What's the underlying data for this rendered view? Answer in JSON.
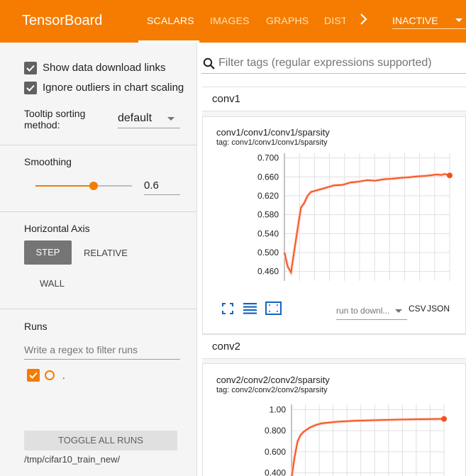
{
  "app": {
    "title": "TensorBoard"
  },
  "tabs": [
    "SCALARS",
    "IMAGES",
    "GRAPHS",
    "DIST"
  ],
  "tab_more_icon": "chevron-right-icon",
  "status_select": {
    "value": "INACTIVE"
  },
  "colors": {
    "brand": "#f57c00",
    "sidebar_bg": "#f5f5f5",
    "series": "#f4511e"
  },
  "sidebar": {
    "show_download_links": {
      "label": "Show data download links",
      "checked": true
    },
    "ignore_outliers": {
      "label": "Ignore outliers in chart scaling",
      "checked": true
    },
    "tooltip_sorting": {
      "label": "Tooltip sorting method:",
      "value": "default"
    },
    "smoothing": {
      "label": "Smoothing",
      "value": "0.6",
      "fraction": 0.6
    },
    "horizontal_axis": {
      "label": "Horizontal Axis",
      "options": [
        "STEP",
        "RELATIVE",
        "WALL"
      ],
      "selected": "STEP"
    },
    "runs": {
      "label": "Runs",
      "filter_placeholder": "Write a regex to filter runs",
      "items": [
        {
          "name": ".",
          "checked": true
        }
      ],
      "toggle_label": "TOGGLE ALL RUNS",
      "logdir": "/tmp/cifar10_train_new/"
    }
  },
  "search": {
    "placeholder": "Filter tags (regular expressions supported)"
  },
  "groups": [
    {
      "name": "conv1",
      "card": {
        "title": "conv1/conv1/conv1/sparsity",
        "tag": "tag: conv1/conv1/conv1/sparsity",
        "download_placeholder": "run to downl...",
        "links": [
          "CSV",
          "JSON"
        ]
      }
    },
    {
      "name": "conv2",
      "card": {
        "title": "conv2/conv2/conv2/sparsity",
        "tag": "tag: conv2/conv2/conv2/sparsity"
      }
    }
  ],
  "chart_data": [
    {
      "type": "line",
      "title": "conv1/conv1/conv1/sparsity",
      "ytick_labels": [
        "0.700",
        "0.660",
        "0.620",
        "0.580",
        "0.540",
        "0.500",
        "0.460"
      ],
      "ylim": [
        0.44,
        0.71
      ],
      "xlim": [
        0,
        1
      ],
      "series": [
        {
          "x": [
            0.0,
            0.02,
            0.04,
            0.06,
            0.08,
            0.1,
            0.12,
            0.14,
            0.16,
            0.2,
            0.25,
            0.3,
            0.35,
            0.4,
            0.45,
            0.5,
            0.55,
            0.6,
            0.65,
            0.7,
            0.75,
            0.8,
            0.85,
            0.88,
            0.92,
            0.95,
            0.97,
            1.0
          ],
          "y": [
            0.5,
            0.47,
            0.458,
            0.505,
            0.55,
            0.595,
            0.605,
            0.62,
            0.628,
            0.632,
            0.637,
            0.642,
            0.643,
            0.648,
            0.65,
            0.653,
            0.652,
            0.655,
            0.656,
            0.658,
            0.659,
            0.661,
            0.662,
            0.663,
            0.665,
            0.664,
            0.666,
            0.663
          ]
        }
      ],
      "grid": true
    },
    {
      "type": "line",
      "title": "conv2/conv2/conv2/sparsity",
      "ytick_labels": [
        "1.00",
        "0.800",
        "0.600",
        "0.400"
      ],
      "ylim": [
        0.35,
        1.05
      ],
      "xlim": [
        0,
        1
      ],
      "series": [
        {
          "x": [
            0.0,
            0.02,
            0.04,
            0.06,
            0.08,
            0.12,
            0.16,
            0.2,
            0.3,
            0.4,
            0.5,
            0.6,
            0.7,
            0.8,
            0.9,
            1.0
          ],
          "y": [
            0.35,
            0.55,
            0.7,
            0.76,
            0.79,
            0.83,
            0.855,
            0.87,
            0.885,
            0.893,
            0.898,
            0.902,
            0.905,
            0.908,
            0.91,
            0.912
          ]
        }
      ],
      "grid": true
    }
  ]
}
